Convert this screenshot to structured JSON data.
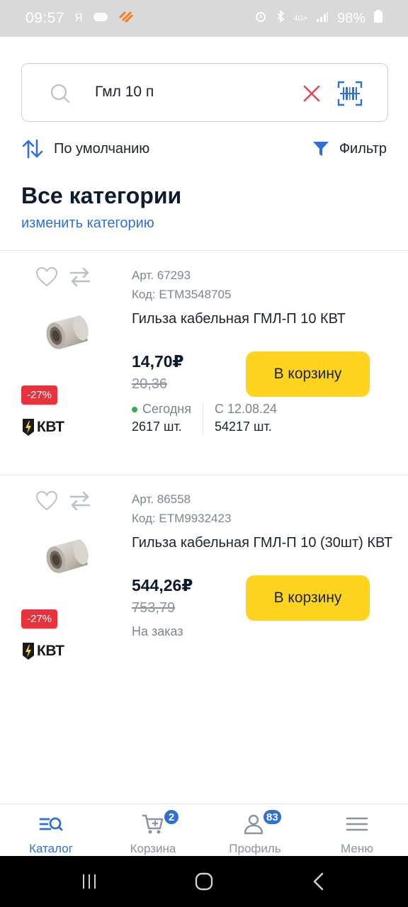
{
  "status_bar": {
    "time": "09:57",
    "left_glyph": "Я",
    "battery": "98%",
    "network": "4G+"
  },
  "search": {
    "value": "Гмл 10 п"
  },
  "sort": {
    "label": "По умолчанию"
  },
  "filter": {
    "label": "Фильтр"
  },
  "category": {
    "title": "Все категории",
    "change_link": "изменить категорию"
  },
  "products": [
    {
      "art": "Арт. 67293",
      "code": "Код: ETM3548705",
      "name": "Гильза кабельная ГМЛ-П 10 КВТ",
      "price": "14,70₽",
      "old_price": "20,36",
      "discount": "-27%",
      "brand": "КВТ",
      "cart_label": "В корзину",
      "stock": [
        {
          "when": "Сегодня",
          "qty": "2617 шт."
        },
        {
          "when": "С 12.08.24",
          "qty": "54217 шт."
        }
      ]
    },
    {
      "art": "Арт. 86558",
      "code": "Код: ETM9932423",
      "name": "Гильза кабельная ГМЛ-П 10 (30шт) КВТ",
      "price": "544,26₽",
      "old_price": "753,79",
      "discount": "-27%",
      "brand": "КВТ",
      "cart_label": "В корзину",
      "availability": "На заказ"
    }
  ],
  "bottom_nav": {
    "catalog": "Каталог",
    "cart": "Корзина",
    "cart_badge": "2",
    "profile": "Профиль",
    "profile_badge": "83",
    "menu": "Меню"
  },
  "colors": {
    "accent": "#2f6fd6",
    "cart_button": "#ffd41f",
    "discount": "#e8333d",
    "in_stock": "#2bb24c"
  }
}
